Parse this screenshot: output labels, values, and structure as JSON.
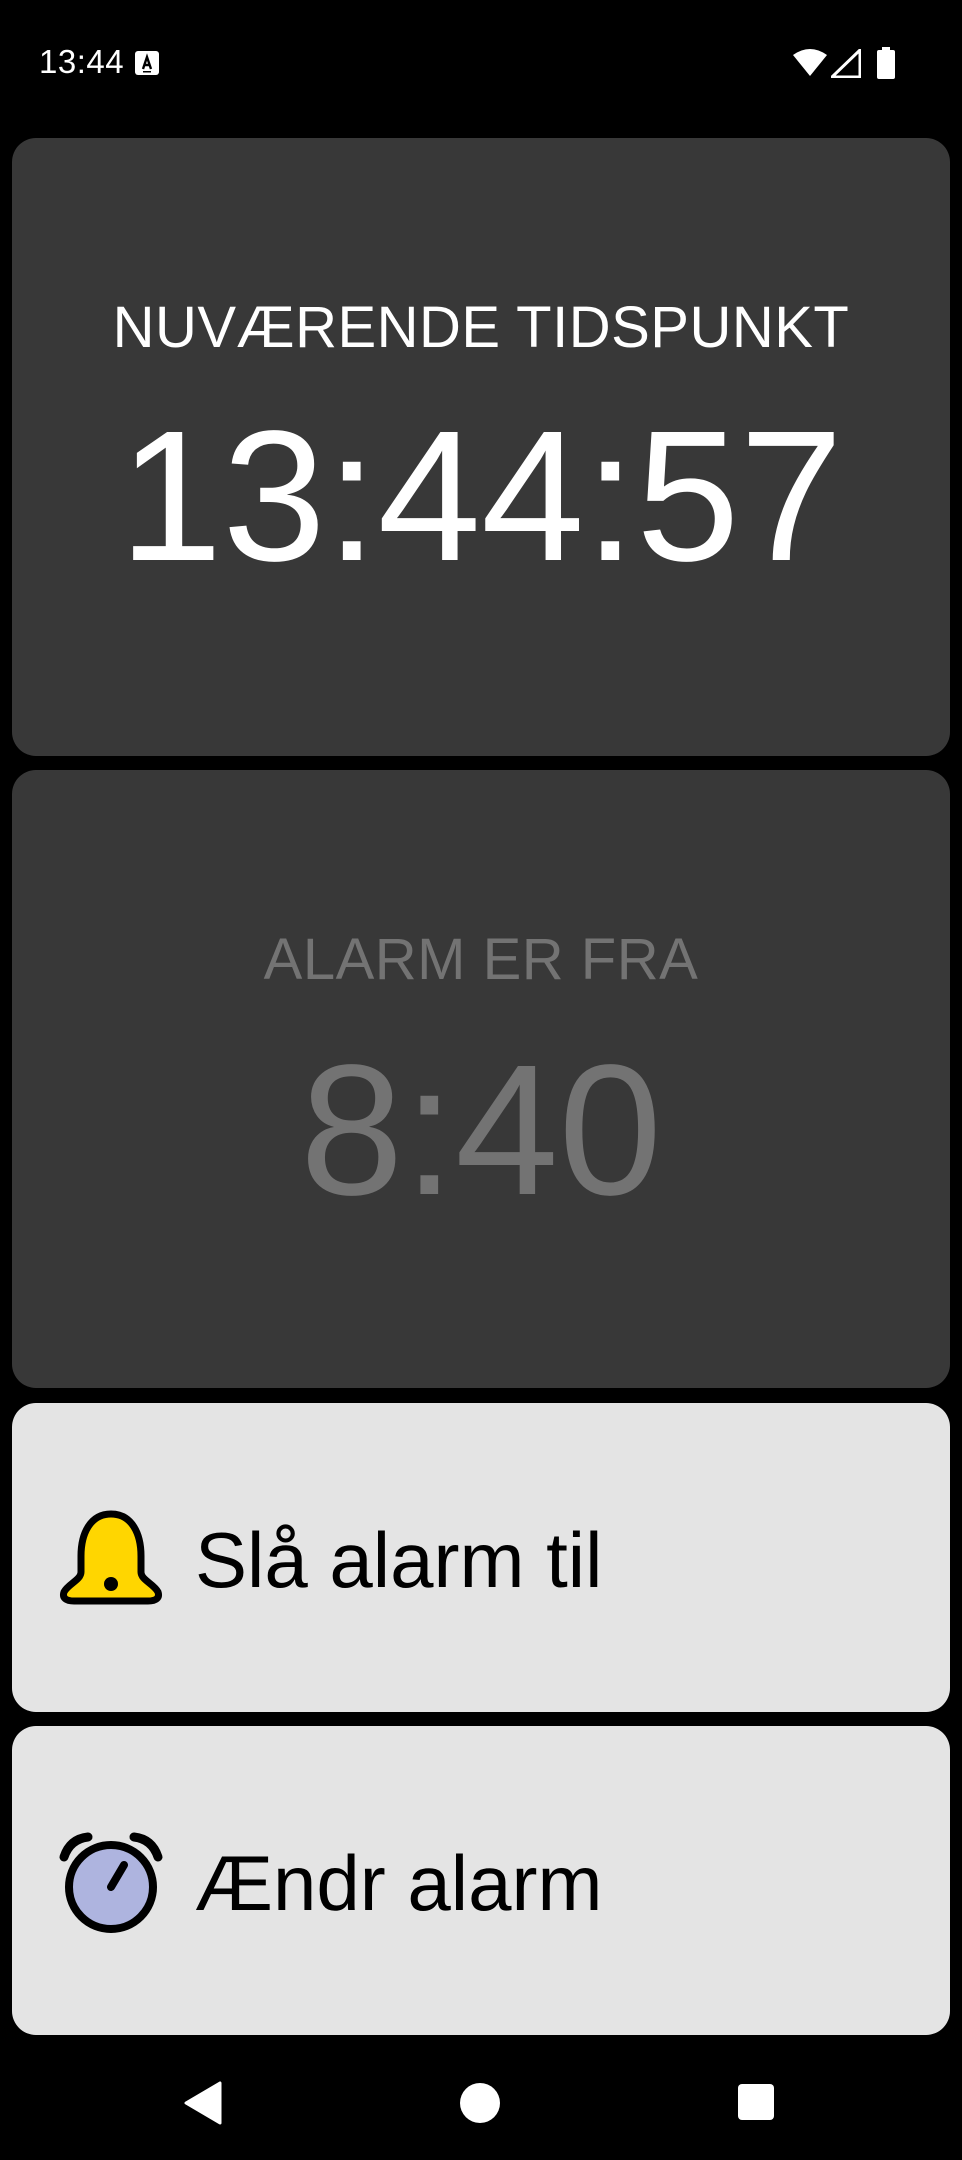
{
  "status_bar": {
    "time": "13:44",
    "icons": [
      "text-input-icon",
      "wifi-icon",
      "signal-icon",
      "battery-icon"
    ]
  },
  "clock": {
    "label": "NUVÆRENDE TIDSPUNKT",
    "time": "13:44:57"
  },
  "alarm": {
    "status_label": "ALARM ER FRA",
    "time": "8:40"
  },
  "buttons": {
    "toggle_label": "Slå alarm til",
    "toggle_icon": "bell-icon",
    "edit_label": "Ændr alarm",
    "edit_icon": "alarm-clock-icon"
  },
  "navigation": {
    "back": "back-icon",
    "home": "home-icon",
    "recents": "recents-icon"
  },
  "colors": {
    "card_dark": "#383838",
    "card_light": "#e4e4e4",
    "alarm_off_text": "#737373",
    "bell_yellow": "#ffd600",
    "clock_face": "#aeb4df"
  }
}
